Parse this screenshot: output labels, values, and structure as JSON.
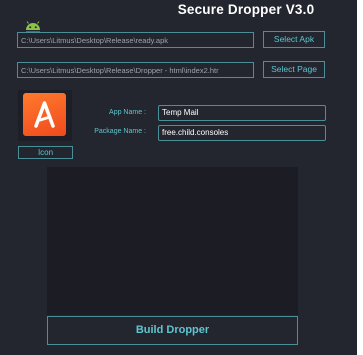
{
  "window": {
    "title": "Secure Dropper V3.0"
  },
  "apk": {
    "path": "C:\\Users\\Litmus\\Desktop\\Release\\ready.apk",
    "button_label": "Select Apk"
  },
  "page": {
    "path": "C:\\Users\\Litmus\\Desktop\\Release\\Dropper - html\\index2.htr",
    "button_label": "Select Page"
  },
  "icon": {
    "button_label": "Icon",
    "image_name": "app-logo-a-icon"
  },
  "form": {
    "app_name_label": "App Name :",
    "app_name_value": "Temp Mail",
    "package_name_label": "Package Name :",
    "package_name_value": "free.child.consoles"
  },
  "actions": {
    "build_label": "Build Dropper"
  },
  "colors": {
    "background": "#23252f",
    "accent": "#5ec6cf",
    "border": "#4b8f98",
    "panel": "#1c1d24",
    "icon_orange": "#f04a1d"
  }
}
